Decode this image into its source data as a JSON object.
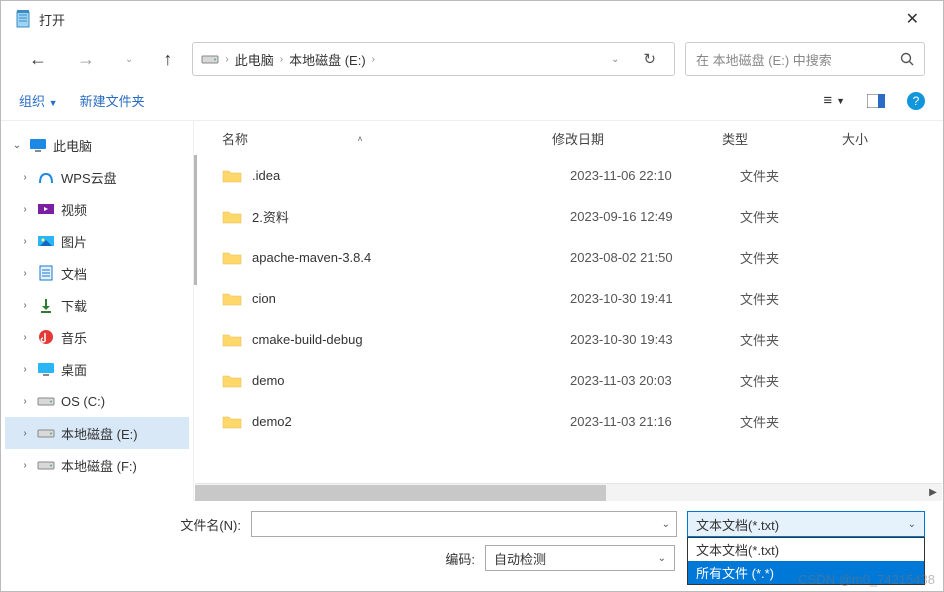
{
  "title": "打开",
  "nav": {
    "crumb1": "此电脑",
    "crumb2": "本地磁盘 (E:)"
  },
  "search": {
    "placeholder": "在 本地磁盘 (E:) 中搜索"
  },
  "toolbar": {
    "organize": "组织",
    "newFolder": "新建文件夹"
  },
  "columns": {
    "name": "名称",
    "date": "修改日期",
    "type": "类型",
    "size": "大小"
  },
  "tree": {
    "root": "此电脑",
    "items": [
      {
        "icon": "wps",
        "label": "WPS云盘"
      },
      {
        "icon": "video",
        "label": "视频"
      },
      {
        "icon": "pic",
        "label": "图片"
      },
      {
        "icon": "doc",
        "label": "文档"
      },
      {
        "icon": "dl",
        "label": "下载"
      },
      {
        "icon": "music",
        "label": "音乐"
      },
      {
        "icon": "desktop",
        "label": "桌面"
      },
      {
        "icon": "drive",
        "label": "OS (C:)"
      },
      {
        "icon": "drive",
        "label": "本地磁盘 (E:)",
        "selected": true
      },
      {
        "icon": "drive",
        "label": "本地磁盘 (F:)"
      }
    ]
  },
  "files": [
    {
      "name": ".idea",
      "date": "2023-11-06 22:10",
      "type": "文件夹"
    },
    {
      "name": "2.资料",
      "date": "2023-09-16 12:49",
      "type": "文件夹"
    },
    {
      "name": "apache-maven-3.8.4",
      "date": "2023-08-02 21:50",
      "type": "文件夹"
    },
    {
      "name": "cion",
      "date": "2023-10-30 19:41",
      "type": "文件夹"
    },
    {
      "name": "cmake-build-debug",
      "date": "2023-10-30 19:43",
      "type": "文件夹"
    },
    {
      "name": "demo",
      "date": "2023-11-03 20:03",
      "type": "文件夹"
    },
    {
      "name": "demo2",
      "date": "2023-11-03 21:16",
      "type": "文件夹"
    }
  ],
  "footer": {
    "fileNameLabel": "文件名(N):",
    "encodingLabel": "编码:",
    "encodingValue": "自动检测",
    "typeSelected": "文本文档(*.txt)",
    "typeOptions": [
      "文本文档(*.txt)",
      "所有文件 (*.*)"
    ]
  },
  "watermark": "CSDN @m0_74215438"
}
